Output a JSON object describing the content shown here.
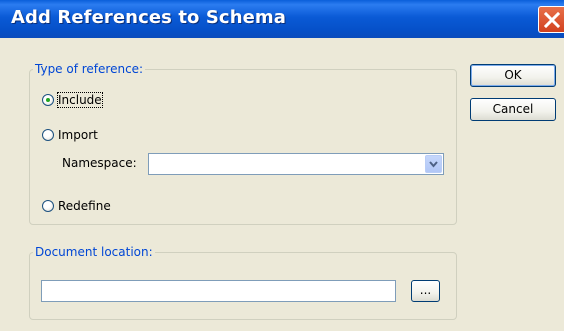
{
  "window": {
    "title": "Add References to Schema"
  },
  "type_group": {
    "legend": "Type of reference:",
    "include_label": "Include",
    "import_label": "Import",
    "namespace_label": "Namespace:",
    "namespace_value": "",
    "redefine_label": "Redefine",
    "selected": "Include"
  },
  "location_group": {
    "legend": "Document location:",
    "path_value": "",
    "browse_label": "..."
  },
  "buttons": {
    "ok": "OK",
    "cancel": "Cancel"
  },
  "icons": {
    "close": "close-icon",
    "dropdown": "chevron-down-icon"
  }
}
